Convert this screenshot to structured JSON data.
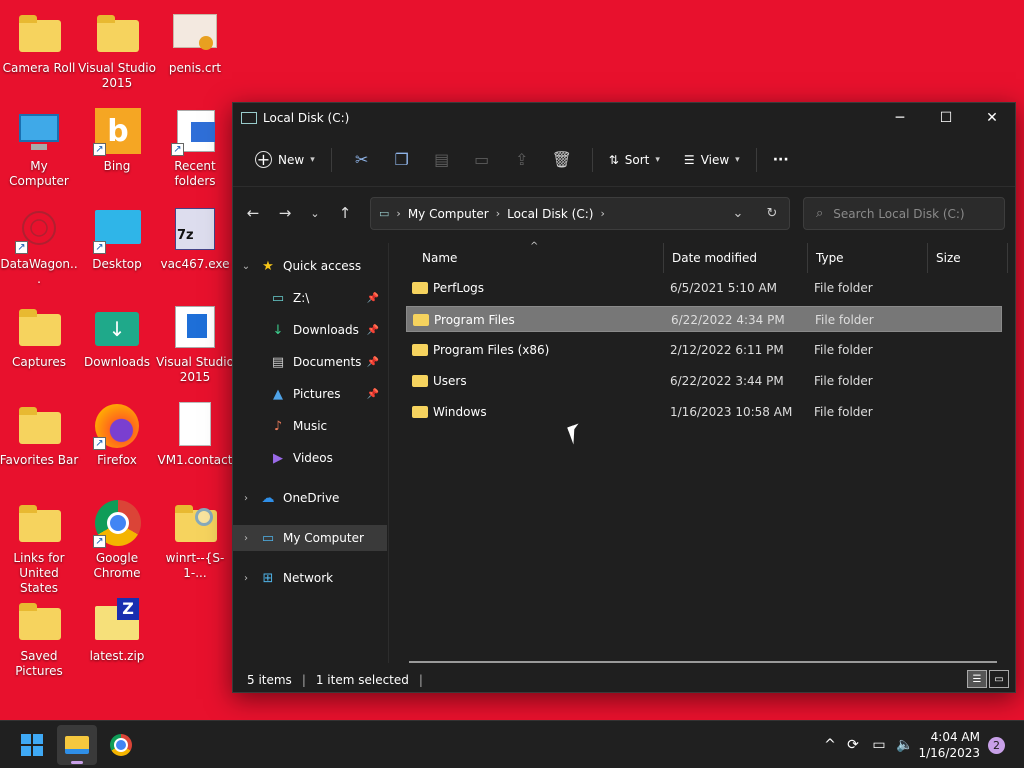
{
  "desktop": {
    "icons": [
      {
        "label": "Camera Roll"
      },
      {
        "label": "Visual Studio 2015"
      },
      {
        "label": "penis.crt"
      },
      {
        "label": "My Computer"
      },
      {
        "label": "Bing"
      },
      {
        "label": "Recent folders"
      },
      {
        "label": "DataWagon..."
      },
      {
        "label": "Desktop"
      },
      {
        "label": "vac467.exe"
      },
      {
        "label": "Captures"
      },
      {
        "label": "Downloads"
      },
      {
        "label": "Visual Studio 2015"
      },
      {
        "label": "Favorites Bar"
      },
      {
        "label": "Firefox"
      },
      {
        "label": "VM1.contact"
      },
      {
        "label": "Links for United States"
      },
      {
        "label": "Google Chrome"
      },
      {
        "label": "winrt--{S-1-..."
      },
      {
        "label": "Saved Pictures"
      },
      {
        "label": "latest.zip"
      }
    ]
  },
  "window": {
    "title": "Local Disk (C:)",
    "toolbar": {
      "new_label": "New",
      "sort_label": "Sort",
      "view_label": "View",
      "more_label": "···"
    },
    "address": {
      "crumb1": "My Computer",
      "crumb2": "Local Disk (C:)"
    },
    "search": {
      "placeholder": "Search Local Disk (C:)"
    },
    "sidebar": {
      "quick_access": "Quick access",
      "items": [
        {
          "label": "Z:\\"
        },
        {
          "label": "Downloads"
        },
        {
          "label": "Documents"
        },
        {
          "label": "Pictures"
        },
        {
          "label": "Music"
        },
        {
          "label": "Videos"
        }
      ],
      "onedrive": "OneDrive",
      "my_computer": "My Computer",
      "network": "Network"
    },
    "columns": {
      "name": "Name",
      "date": "Date modified",
      "type": "Type",
      "size": "Size"
    },
    "files": [
      {
        "name": "PerfLogs",
        "date": "6/5/2021 5:10 AM",
        "type": "File folder"
      },
      {
        "name": "Program Files",
        "date": "6/22/2022 4:34 PM",
        "type": "File folder"
      },
      {
        "name": "Program Files (x86)",
        "date": "2/12/2022 6:11 PM",
        "type": "File folder"
      },
      {
        "name": "Users",
        "date": "6/22/2022 3:44 PM",
        "type": "File folder"
      },
      {
        "name": "Windows",
        "date": "1/16/2023 10:58 AM",
        "type": "File folder"
      }
    ],
    "status": {
      "count": "5 items",
      "selected": "1 item selected"
    }
  },
  "taskbar": {
    "time": "4:04 AM",
    "date": "1/16/2023",
    "notifications": "2"
  },
  "colors": {
    "desktop": "#e8112d",
    "window_bg": "#1f1f1f",
    "accent": "#c8a0e8"
  }
}
